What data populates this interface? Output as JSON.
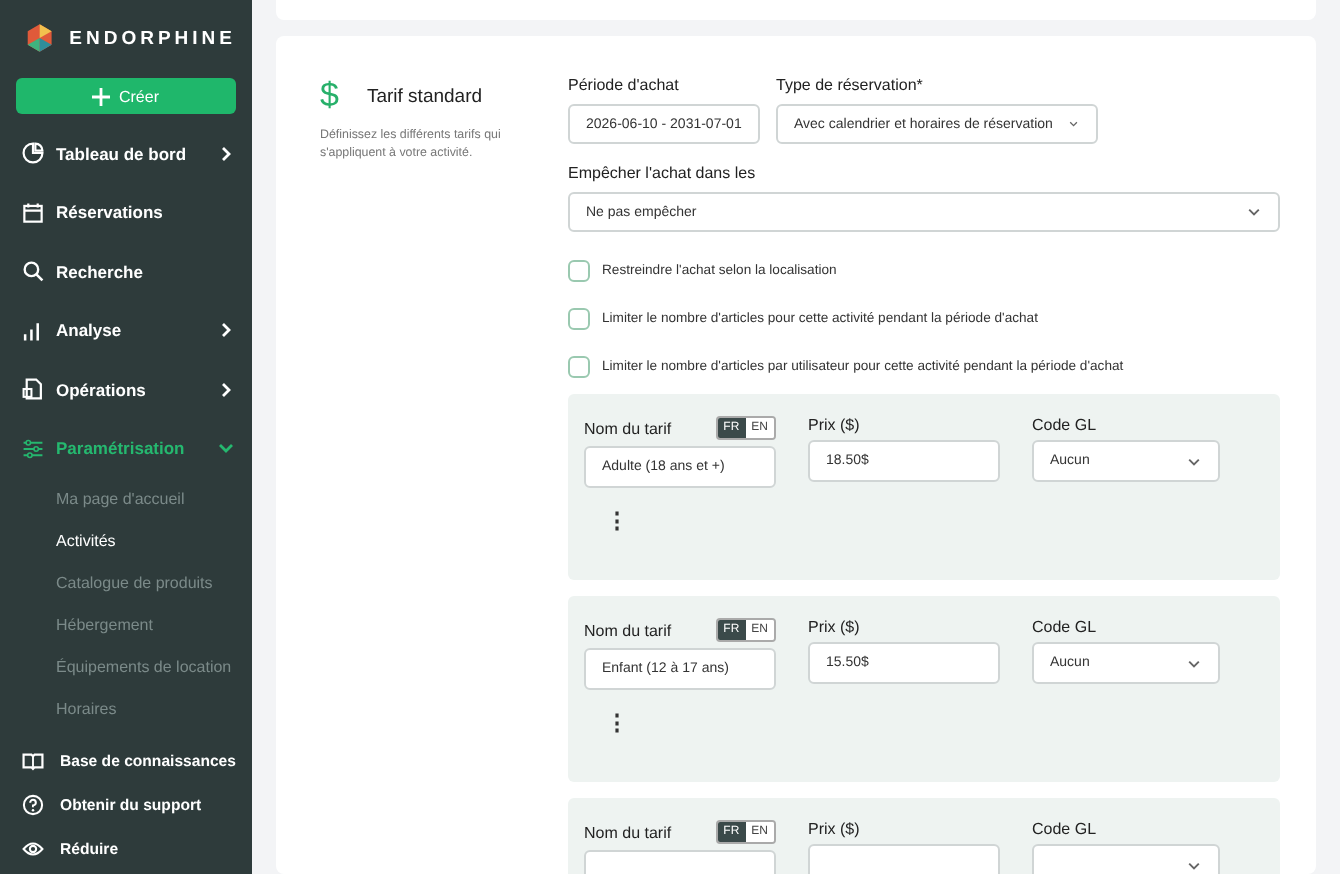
{
  "brand": "ENDORPHINE",
  "create_button": "Créer",
  "nav": [
    {
      "label": "Tableau de bord",
      "selected": false,
      "expanded": false
    },
    {
      "label": "Réservations",
      "selected": false
    },
    {
      "label": "Recherche",
      "selected": false
    },
    {
      "label": "Analyse",
      "selected": false,
      "expanded": false
    },
    {
      "label": "Opérations",
      "selected": false,
      "expanded": false
    },
    {
      "label": "Paramétrisation",
      "selected": true,
      "expanded": true,
      "children": [
        {
          "label": "Ma page d'accueil",
          "selected": false
        },
        {
          "label": "Activités",
          "selected": true
        },
        {
          "label": "Catalogue de produits",
          "selected": false
        },
        {
          "label": "Hébergement",
          "selected": false
        },
        {
          "label": "Équipements de location",
          "selected": false
        },
        {
          "label": "Horaires",
          "selected": false
        }
      ]
    }
  ],
  "bottom_nav": [
    {
      "label": "Base de connaissances"
    },
    {
      "label": "Obtenir du support"
    },
    {
      "label": "Réduire"
    }
  ],
  "section": {
    "icon": "$",
    "title": "Tarif standard",
    "description": "Définissez les différents tarifs qui s'appliquent à votre activité."
  },
  "purchase_period": {
    "label": "Période d'achat",
    "value": "2026-06-10 - 2031-07-01"
  },
  "booking_type": {
    "label": "Type de réservation*",
    "value": "Avec calendrier et horaires de réservation"
  },
  "prevent_purchase": {
    "label": "Empêcher l'achat dans les",
    "value": "Ne pas empêcher"
  },
  "checkboxes": [
    {
      "label": "Restreindre l'achat selon la localisation",
      "checked": false
    },
    {
      "label": "Limiter le nombre d'articles pour cette activité pendant la période d'achat",
      "checked": false
    },
    {
      "label": "Limiter le nombre d'articles par utilisateur pour cette activité pendant la période d'achat",
      "checked": false
    }
  ],
  "tariffs": [
    {
      "name_label": "Nom du tarif",
      "languages": [
        {
          "label": "FR",
          "selected": true
        },
        {
          "label": "EN",
          "selected": false
        }
      ],
      "name": "Adulte (18 ans et +)",
      "price_label": "Prix ($)",
      "price": "18.50$",
      "gl_label": "Code GL",
      "gl": "Aucun",
      "menu_icon": "⋮"
    },
    {
      "name_label": "Nom du tarif",
      "languages": [
        {
          "label": "FR",
          "selected": true
        },
        {
          "label": "EN",
          "selected": false
        }
      ],
      "name": "Enfant (12 à 17 ans)",
      "price_label": "Prix ($)",
      "price": "15.50$",
      "gl_label": "Code GL",
      "gl": "Aucun",
      "menu_icon": "⋮"
    },
    {
      "name_label": "Nom du tarif",
      "languages": [
        {
          "label": "FR",
          "selected": true
        },
        {
          "label": "EN",
          "selected": false
        }
      ],
      "price_label": "Prix ($)",
      "gl_label": "Code GL"
    }
  ]
}
